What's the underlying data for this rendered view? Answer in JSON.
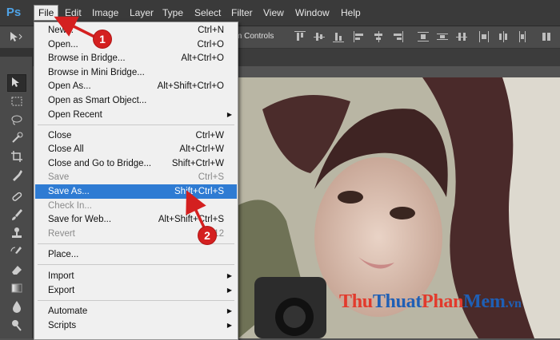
{
  "app": {
    "logo": "Ps"
  },
  "menubar": {
    "items": [
      "File",
      "Edit",
      "Image",
      "Layer",
      "Type",
      "Select",
      "Filter",
      "View",
      "Window",
      "Help"
    ],
    "active": "File"
  },
  "options_bar": {
    "controls_label": "m Controls"
  },
  "file_menu": {
    "items": [
      {
        "label": "New...",
        "shortcut": "Ctrl+N"
      },
      {
        "label": "Open...",
        "shortcut": "Ctrl+O"
      },
      {
        "label": "Browse in Bridge...",
        "shortcut": "Alt+Ctrl+O"
      },
      {
        "label": "Browse in Mini Bridge...",
        "shortcut": ""
      },
      {
        "label": "Open As...",
        "shortcut": "Alt+Shift+Ctrl+O"
      },
      {
        "label": "Open as Smart Object...",
        "shortcut": ""
      },
      {
        "label": "Open Recent",
        "shortcut": ""
      },
      {
        "label": "Close",
        "shortcut": "Ctrl+W"
      },
      {
        "label": "Close All",
        "shortcut": "Alt+Ctrl+W"
      },
      {
        "label": "Close and Go to Bridge...",
        "shortcut": "Shift+Ctrl+W"
      },
      {
        "label": "Save",
        "shortcut": "Ctrl+S"
      },
      {
        "label": "Save As...",
        "shortcut": "Shift+Ctrl+S"
      },
      {
        "label": "Check In...",
        "shortcut": ""
      },
      {
        "label": "Save for Web...",
        "shortcut": "Alt+Shift+Ctrl+S"
      },
      {
        "label": "Revert",
        "shortcut": "F12"
      },
      {
        "label": "Place...",
        "shortcut": ""
      },
      {
        "label": "Import",
        "shortcut": ""
      },
      {
        "label": "Export",
        "shortcut": ""
      },
      {
        "label": "Automate",
        "shortcut": ""
      },
      {
        "label": "Scripts",
        "shortcut": ""
      }
    ],
    "highlighted": "Save As...",
    "disabled": [
      "Save",
      "Check In...",
      "Revert"
    ],
    "submenus": [
      "Open Recent",
      "Import",
      "Export",
      "Automate",
      "Scripts"
    ]
  },
  "annotations": {
    "step1": "1",
    "step2": "2"
  },
  "watermark": {
    "part1": "Thu",
    "part2": "Thuat",
    "part3": "Phan",
    "part4": "Mem",
    "part5": ".vn"
  },
  "colors": {
    "highlight": "#2e7bd3",
    "badge": "#d42020",
    "menubar_bg": "#3a3a3a"
  }
}
